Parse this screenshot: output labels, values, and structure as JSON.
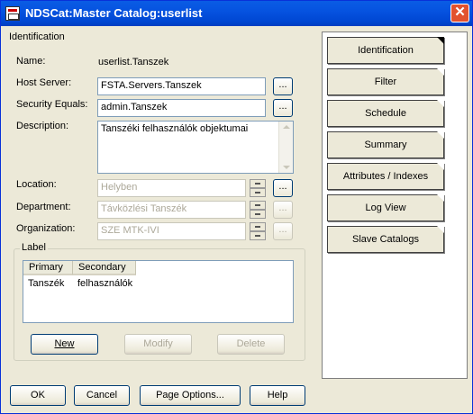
{
  "window": {
    "title": "NDSCat:Master Catalog:userlist",
    "close_glyph": "✕"
  },
  "identification": {
    "group_title": "Identification",
    "name_label": "Name:",
    "name_value": "userlist.Tanszek",
    "host_server_label": "Host Server:",
    "host_server_value": "FSTA.Servers.Tanszek",
    "security_equals_label": "Security Equals:",
    "security_equals_value": "admin.Tanszek",
    "description_label": "Description:",
    "description_value": "Tanszéki felhasználók objektumai",
    "location_label": "Location:",
    "location_value": "Helyben",
    "department_label": "Department:",
    "department_value": "Távközlési Tanszék",
    "organization_label": "Organization:",
    "organization_value": "SZE MTK-IVI",
    "browse_label": "...",
    "label_group": {
      "title": "Label",
      "columns": [
        "Primary",
        "Secondary"
      ],
      "rows": [
        {
          "primary": "Tanszék",
          "secondary": "felhasználók"
        }
      ],
      "new_button": "New",
      "modify_button": "Modify",
      "delete_button": "Delete"
    }
  },
  "footer": {
    "ok": "OK",
    "cancel": "Cancel",
    "page_options": "Page Options...",
    "help": "Help"
  },
  "pages": [
    {
      "label": "Identification",
      "active": true
    },
    {
      "label": "Filter",
      "active": false
    },
    {
      "label": "Schedule",
      "active": false
    },
    {
      "label": "Summary",
      "active": false
    },
    {
      "label": "Attributes / Indexes",
      "active": false
    },
    {
      "label": "Log View",
      "active": false
    },
    {
      "label": "Slave Catalogs",
      "active": false
    }
  ]
}
